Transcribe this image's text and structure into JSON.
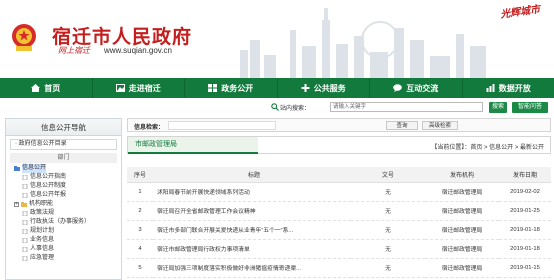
{
  "header": {
    "title": "宿迁市人民政府",
    "slogan": "网上宿迁",
    "url": "www.suqian.gov.cn",
    "corner_logo": "光辉城市"
  },
  "nav": {
    "items": [
      {
        "label": "首页",
        "icon": "home-icon"
      },
      {
        "label": "走进宿迁",
        "icon": "image-icon"
      },
      {
        "label": "政务公开",
        "icon": "grid-icon"
      },
      {
        "label": "公共服务",
        "icon": "cross-icon"
      },
      {
        "label": "互动交流",
        "icon": "chat-icon"
      },
      {
        "label": "数据开放",
        "icon": "chart-icon"
      }
    ]
  },
  "site_search": {
    "label": "站内搜索：",
    "placeholder": "请输入关键字",
    "search_button": "搜索",
    "accessibility_button": "智能问答"
  },
  "sidebar": {
    "title": "信息公开导航",
    "directory": "· 政府信息公开目录",
    "category": "部门",
    "tree": [
      {
        "label": "信息公开",
        "level": 0,
        "selected": true,
        "expand": false
      },
      {
        "label": "信息公开指南",
        "level": 1
      },
      {
        "label": "信息公开制度",
        "level": 1
      },
      {
        "label": "信息公开年报",
        "level": 1
      },
      {
        "label": "机构职能",
        "level": 1,
        "expand": true
      },
      {
        "label": "政策法规",
        "level": 1
      },
      {
        "label": "行政执法（办事服务）",
        "level": 1
      },
      {
        "label": "规划计划",
        "level": 1
      },
      {
        "label": "业务信息",
        "level": 1
      },
      {
        "label": "人事信息",
        "level": 1
      },
      {
        "label": "应急管理",
        "level": 1
      }
    ]
  },
  "main_search": {
    "label": "信息检索：",
    "query_button": "查询",
    "advanced_button": "高级检索"
  },
  "location": {
    "tab": "市邮政管理局",
    "breadcrumb": "【当前位置】：首页 > 信息公开 > 最新公开"
  },
  "table": {
    "headers": {
      "no": "序号",
      "title": "标题",
      "doc": "文号",
      "org": "发布机构",
      "date": "发布日期"
    },
    "rows": [
      {
        "no": "1",
        "title": "沭阳局春节前开展快递领域系列活动",
        "doc": "无",
        "org": "宿迁邮政管理局",
        "date": "2019-02-02"
      },
      {
        "no": "2",
        "title": "宿迁局召开全省邮政管理工作会议精神",
        "doc": "无",
        "org": "宿迁邮政管理局",
        "date": "2019-01-25"
      },
      {
        "no": "3",
        "title": "宿迁市多部门联合开展关爱快递从业青年“五个一”系...",
        "doc": "无",
        "org": "宿迁邮政管理局",
        "date": "2019-01-18"
      },
      {
        "no": "4",
        "title": "宿迁市邮政管理局行政权力事项清单",
        "doc": "无",
        "org": "宿迁邮政管理局",
        "date": "2019-01-18"
      },
      {
        "no": "5",
        "title": "宿迁局加强三项制度落实积极做好非洲猪瘟疫情寄递渠...",
        "doc": "无",
        "org": "宿迁邮政管理局",
        "date": "2019-01-15"
      }
    ]
  },
  "colors": {
    "brand_red": "#c41e1e",
    "nav_green": "#127a3c",
    "accent_green": "#1a8a46"
  }
}
